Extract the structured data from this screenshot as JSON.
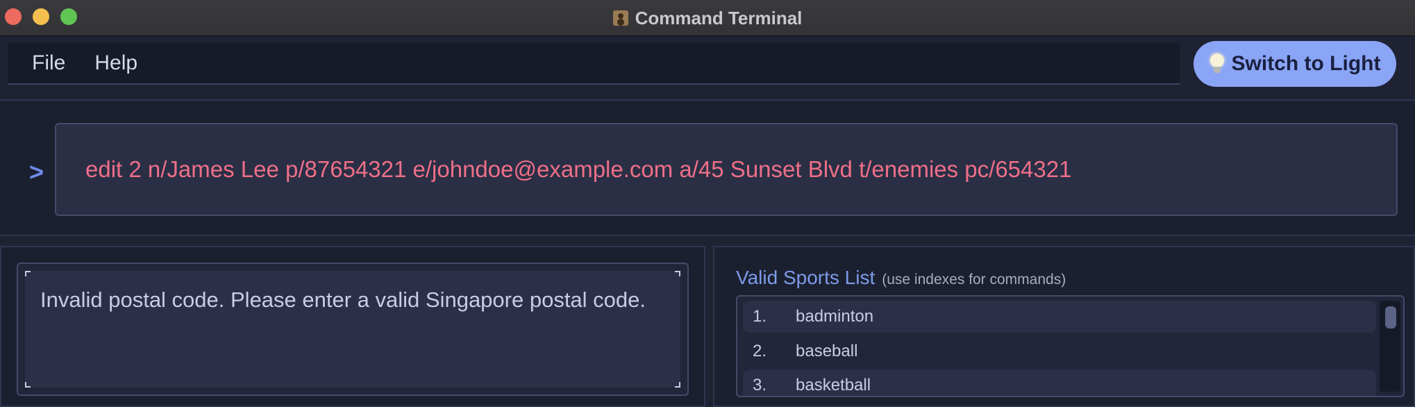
{
  "window": {
    "title": "Command Terminal"
  },
  "menu": {
    "items": [
      "File",
      "Help"
    ]
  },
  "theme_button": {
    "label": "Switch to Light",
    "icon": "lightbulb-icon"
  },
  "command": {
    "prompt": ">",
    "value": "edit 2 n/James Lee p/87654321 e/johndoe@example.com a/45 Sunset Blvd t/enemies pc/654321"
  },
  "result": {
    "message": "Invalid postal code. Please enter a valid Singapore postal code."
  },
  "sports": {
    "title": "Valid Sports List",
    "hint": "(use indexes for commands)",
    "items": [
      {
        "index": "1.",
        "name": "badminton"
      },
      {
        "index": "2.",
        "name": "baseball"
      },
      {
        "index": "3.",
        "name": "basketball"
      }
    ]
  },
  "colors": {
    "accent": "#8aa4f6",
    "command_text": "#ef6f88",
    "background": "#1e2233"
  }
}
